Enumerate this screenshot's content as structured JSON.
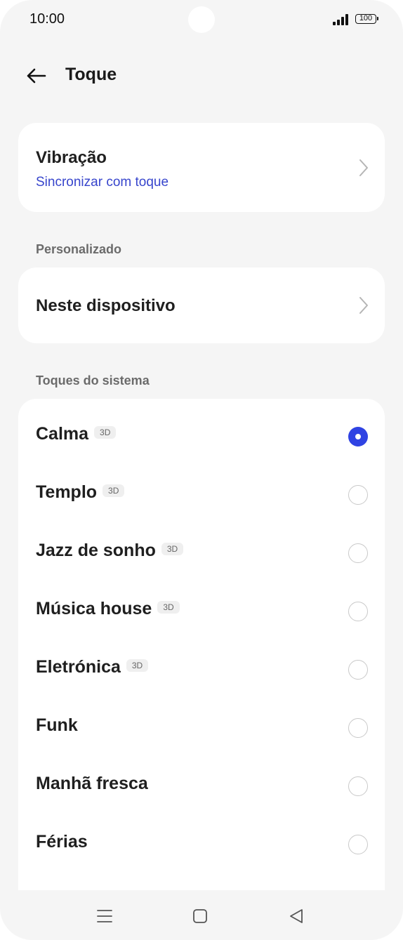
{
  "status_bar": {
    "time": "10:00",
    "battery": "100"
  },
  "header": {
    "title": "Toque"
  },
  "vibration": {
    "title": "Vibração",
    "subtitle": "Sincronizar com toque"
  },
  "custom": {
    "section_label": "Personalizado",
    "item": "Neste dispositivo"
  },
  "system": {
    "section_label": "Toques do sistema",
    "tones": [
      {
        "name": "Calma",
        "badge": "3D",
        "selected": true
      },
      {
        "name": "Templo",
        "badge": "3D",
        "selected": false
      },
      {
        "name": "Jazz de sonho",
        "badge": "3D",
        "selected": false
      },
      {
        "name": "Música house",
        "badge": "3D",
        "selected": false
      },
      {
        "name": "Eletrónica",
        "badge": "3D",
        "selected": false
      },
      {
        "name": "Funk",
        "selected": false
      },
      {
        "name": "Manhã fresca",
        "selected": false
      },
      {
        "name": "Férias",
        "selected": false
      }
    ]
  },
  "colors": {
    "accent": "#2f43e3",
    "link": "#3745cc",
    "background": "#f5f5f5"
  }
}
